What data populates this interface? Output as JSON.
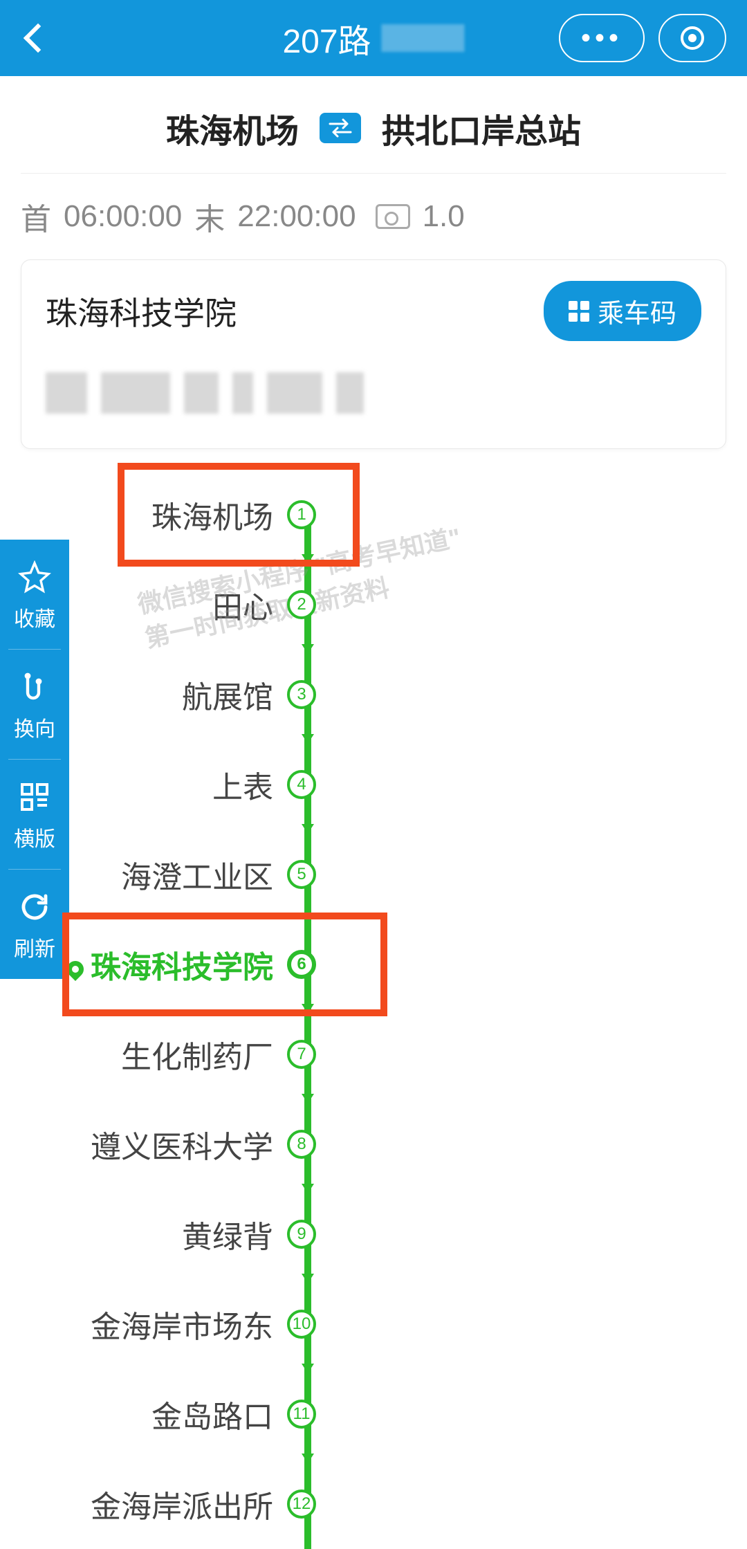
{
  "header": {
    "title": "207路"
  },
  "route": {
    "start": "珠海机场",
    "end": "拱北口岸总站"
  },
  "schedule": {
    "first_label": "首",
    "first_time": "06:00:00",
    "last_label": "末",
    "last_time": "22:00:00",
    "fare": "1.0"
  },
  "card": {
    "nearest_station": "珠海科技学院",
    "ride_code_label": "乘车码"
  },
  "stations": [
    {
      "num": "1",
      "name": "珠海机场",
      "current": false
    },
    {
      "num": "2",
      "name": "田心",
      "current": false
    },
    {
      "num": "3",
      "name": "航展馆",
      "current": false
    },
    {
      "num": "4",
      "name": "上表",
      "current": false
    },
    {
      "num": "5",
      "name": "海澄工业区",
      "current": false
    },
    {
      "num": "6",
      "name": "珠海科技学院",
      "current": true
    },
    {
      "num": "7",
      "name": "生化制药厂",
      "current": false
    },
    {
      "num": "8",
      "name": "遵义医科大学",
      "current": false
    },
    {
      "num": "9",
      "name": "黄绿背",
      "current": false
    },
    {
      "num": "10",
      "name": "金海岸市场东",
      "current": false
    },
    {
      "num": "11",
      "name": "金岛路口",
      "current": false
    },
    {
      "num": "12",
      "name": "金海岸派出所",
      "current": false
    }
  ],
  "highlight_indices": [
    0,
    5
  ],
  "side_tools": {
    "fav": "收藏",
    "swap": "换向",
    "layout": "横版",
    "refresh": "刷新"
  },
  "watermark": {
    "line1": "微信搜索小程序 \"高考早知道\"",
    "line2": "第一时间获取最新资料"
  }
}
